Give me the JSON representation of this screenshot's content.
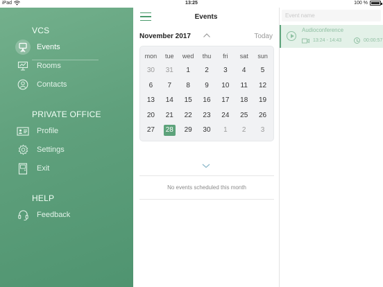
{
  "status_bar": {
    "device": "iPad",
    "time": "13:25",
    "battery": "100 %"
  },
  "sidebar": {
    "sections": [
      {
        "title": "VCS",
        "items": [
          {
            "label": "Events",
            "icon": "easel-icon",
            "active": true
          },
          {
            "label": "Rooms",
            "icon": "presentation-board-icon"
          },
          {
            "label": "Contacts",
            "icon": "person-circle-icon"
          }
        ]
      },
      {
        "title": "PRIVATE OFFICE",
        "items": [
          {
            "label": "Profile",
            "icon": "id-card-icon"
          },
          {
            "label": "Settings",
            "icon": "gear-icon"
          },
          {
            "label": "Exit",
            "icon": "door-exit-icon"
          }
        ]
      },
      {
        "title": "HELP",
        "items": [
          {
            "label": "Feedback",
            "icon": "headset-icon"
          }
        ]
      }
    ]
  },
  "header": {
    "title": "Events"
  },
  "calendar": {
    "month_label": "November 2017",
    "today_label": "Today",
    "weekdays": [
      "mon",
      "tue",
      "wed",
      "thu",
      "fri",
      "sat",
      "sun"
    ],
    "weeks": [
      [
        "30",
        "31",
        "1",
        "2",
        "3",
        "4",
        "5"
      ],
      [
        "6",
        "7",
        "8",
        "9",
        "10",
        "11",
        "12"
      ],
      [
        "13",
        "14",
        "15",
        "16",
        "17",
        "18",
        "19"
      ],
      [
        "20",
        "21",
        "22",
        "23",
        "24",
        "25",
        "26"
      ],
      [
        "27",
        "28",
        "29",
        "30",
        "1",
        "2",
        "3"
      ]
    ],
    "selected_day": "28",
    "no_events_text": "No events scheduled this month"
  },
  "search": {
    "placeholder": "Event name"
  },
  "events": [
    {
      "title": "Audioconference",
      "time": "13:24 - 14:43",
      "duration": "00:00:57"
    }
  ],
  "colors": {
    "accent": "#5da37b",
    "sidebar_bg": "#62a480",
    "event_bg": "#e3f1e8"
  }
}
